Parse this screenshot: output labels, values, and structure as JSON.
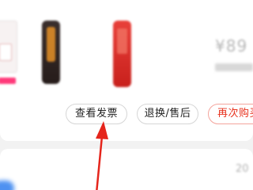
{
  "order": {
    "price_fragment": "¥89",
    "actions": {
      "view_invoice": "查看发票",
      "return_exchange": "退换/售后",
      "buy_again": "再次购买"
    }
  },
  "next_order": {
    "meta_fragment": "20"
  },
  "colors": {
    "accent_red": "#e8331f",
    "annotation_arrow": "#e5251c",
    "button_border": "#d6d6d6",
    "buy_again_border": "#f4a49c"
  }
}
